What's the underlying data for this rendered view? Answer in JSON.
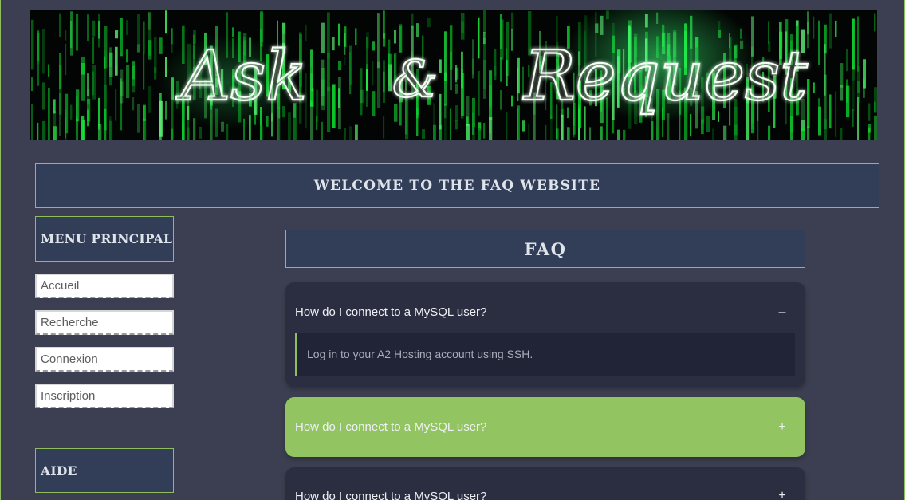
{
  "banner": {
    "word1": "Ask",
    "ampersand": "&",
    "word2": "Request"
  },
  "welcome": "WELCOME TO THE FAQ WEBSITE",
  "sidebar": {
    "menu_title": "MENU PRINCIPAL",
    "items": [
      {
        "label": "Accueil"
      },
      {
        "label": "Recherche"
      },
      {
        "label": "Connexion"
      },
      {
        "label": "Inscription"
      }
    ],
    "help_title": "AIDE"
  },
  "faq": {
    "title": "FAQ",
    "items": [
      {
        "question": "How do I connect to a MySQL user?",
        "answer": "Log in to your A2 Hosting account using SSH.",
        "toggle": "–",
        "state": "expanded"
      },
      {
        "question": "How do I connect to a MySQL user?",
        "toggle": "+",
        "state": "highlighted"
      },
      {
        "question": "How do I connect to a MySQL user?",
        "toggle": "+",
        "state": "collapsed"
      }
    ]
  },
  "colors": {
    "background": "#3c3f51",
    "panel": "#323d58",
    "accent_green": "#8fbf5c",
    "highlight": "#92c462",
    "faq_card": "#2a2e40"
  }
}
